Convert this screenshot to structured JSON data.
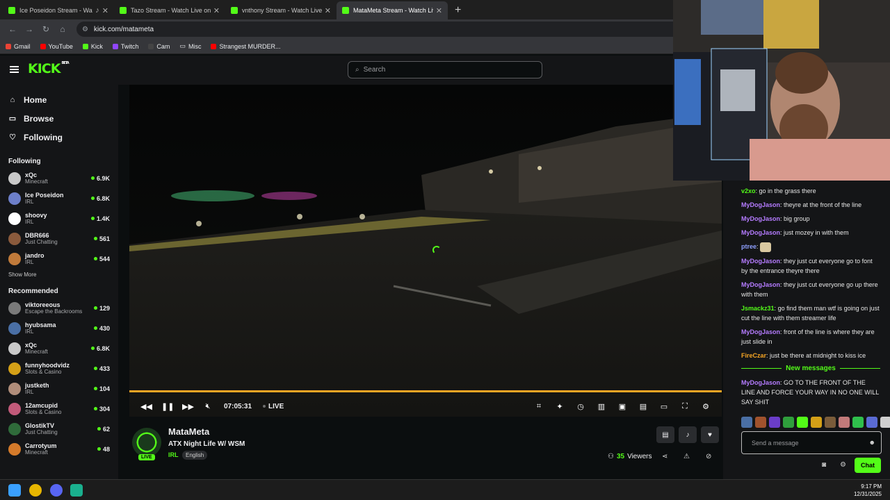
{
  "browser": {
    "tabs": [
      {
        "title": "Ice Poseidon Stream - Watch Live on Kick",
        "active": false,
        "muted_icon": "speaker-icon"
      },
      {
        "title": "Tazo Stream - Watch Live on Kick",
        "active": false
      },
      {
        "title": "vnthony Stream - Watch Live on Kick",
        "active": false
      },
      {
        "title": "MataMeta Stream - Watch Live on Kick",
        "active": true
      }
    ],
    "new_tab": "+",
    "url": "kick.com/matameta",
    "bookmarks": [
      {
        "label": "Gmail",
        "color": "#ea4335"
      },
      {
        "label": "YouTube",
        "color": "#ff0000"
      },
      {
        "label": "Kick",
        "color": "#53fc18"
      },
      {
        "label": "Twitch",
        "color": "#9146ff"
      },
      {
        "label": "Cam",
        "color": "#444444"
      },
      {
        "label": "Misc",
        "color": "#777777"
      },
      {
        "label": "Strangest MURDER...",
        "color": "#ff0000"
      }
    ]
  },
  "kick": {
    "logo": "KICK",
    "logo_badge": "BETA",
    "search_placeholder": "Search",
    "nav": [
      {
        "label": "Home",
        "icon": "home-icon",
        "glyph": "⌂"
      },
      {
        "label": "Browse",
        "icon": "browse-icon",
        "glyph": "▭"
      },
      {
        "label": "Following",
        "icon": "heart-icon",
        "glyph": "♡"
      }
    ],
    "following_title": "Following",
    "following": [
      {
        "name": "xQc",
        "category": "Minecraft",
        "viewers": "6.9K",
        "color": "#c9c9c9"
      },
      {
        "name": "Ice Poseidon",
        "category": "IRL",
        "viewers": "6.8K",
        "color": "#6d7fc9"
      },
      {
        "name": "shoovy",
        "category": "IRL",
        "viewers": "1.4K",
        "color": "#ffffff"
      },
      {
        "name": "DBR666",
        "category": "Just Chatting",
        "viewers": "561",
        "color": "#8a5a3c"
      },
      {
        "name": "jandro",
        "category": "IRL",
        "viewers": "544",
        "color": "#c07a3a"
      }
    ],
    "show_more": "Show More",
    "recommended_title": "Recommended",
    "recommended": [
      {
        "name": "viktoreeous",
        "category": "Escape the Backrooms",
        "viewers": "129",
        "color": "#7a7a7a"
      },
      {
        "name": "hyubsama",
        "category": "IRL",
        "viewers": "430",
        "color": "#4a6fa5"
      },
      {
        "name": "xQc",
        "category": "Minecraft",
        "viewers": "6.8K",
        "color": "#c9c9c9"
      },
      {
        "name": "funnyhoodvidz",
        "category": "Slots & Casino",
        "viewers": "433",
        "color": "#d4a017"
      },
      {
        "name": "justketh",
        "category": "IRL",
        "viewers": "104",
        "color": "#b08d7a"
      },
      {
        "name": "12amcupid",
        "category": "Slots & Casino",
        "viewers": "304",
        "color": "#c25a7a"
      },
      {
        "name": "GlostikTV",
        "category": "Just Chatting",
        "viewers": "62",
        "color": "#2f6b3a"
      },
      {
        "name": "Carrotyum",
        "category": "Minecraft",
        "viewers": "48",
        "color": "#d47a2a"
      }
    ]
  },
  "player": {
    "time": "07:05:31",
    "live": "LIVE",
    "progress": 1.0
  },
  "stream": {
    "name": "MataMeta",
    "title": "ATX Night Life W/ WSM",
    "category": "IRL",
    "language": "English",
    "live_badge": "LIVE",
    "viewers_count": "35",
    "viewers_label": "Viewers"
  },
  "chat": {
    "messages": [
      {
        "user": "v2xo",
        "color": "#53fc18",
        "text": "go in the grass there"
      },
      {
        "user": "MyDogJason",
        "color": "#b57cff",
        "text": "theyre at the front of the line"
      },
      {
        "user": "MyDogJason",
        "color": "#b57cff",
        "text": "big group"
      },
      {
        "user": "MyDogJason",
        "color": "#b57cff",
        "text": "just mozey in with them"
      },
      {
        "user": "ptree",
        "color": "#8fa0ff",
        "text": ""
      },
      {
        "user": "MyDogJason",
        "color": "#b57cff",
        "text": "they just cut everyone go to font by the entrance theyre there"
      },
      {
        "user": "MyDogJason",
        "color": "#b57cff",
        "text": "they just cut everyone go up there with them"
      },
      {
        "user": "Jsmackz31",
        "color": "#53fc18",
        "text": "go find them man wtf is going on just cut the line with them streamer life"
      },
      {
        "user": "MyDogJason",
        "color": "#b57cff",
        "text": "front of the line is where they are just slide in"
      },
      {
        "user": "FireCzar",
        "color": "#f5a524",
        "text": "just be there at midnight to kiss ice"
      }
    ],
    "new_messages": "New messages",
    "last_message": {
      "user": "MyDogJason",
      "color": "#b57cff",
      "text": "GO TO THE FRONT OF THE LINE AND FORCE YOUR WAY IN NO ONE WILL SAY SHIT"
    },
    "input_placeholder": "Send a message",
    "send_label": "Chat"
  },
  "taskbar": {
    "time": "9:17 PM",
    "date": "12/31/2025"
  }
}
